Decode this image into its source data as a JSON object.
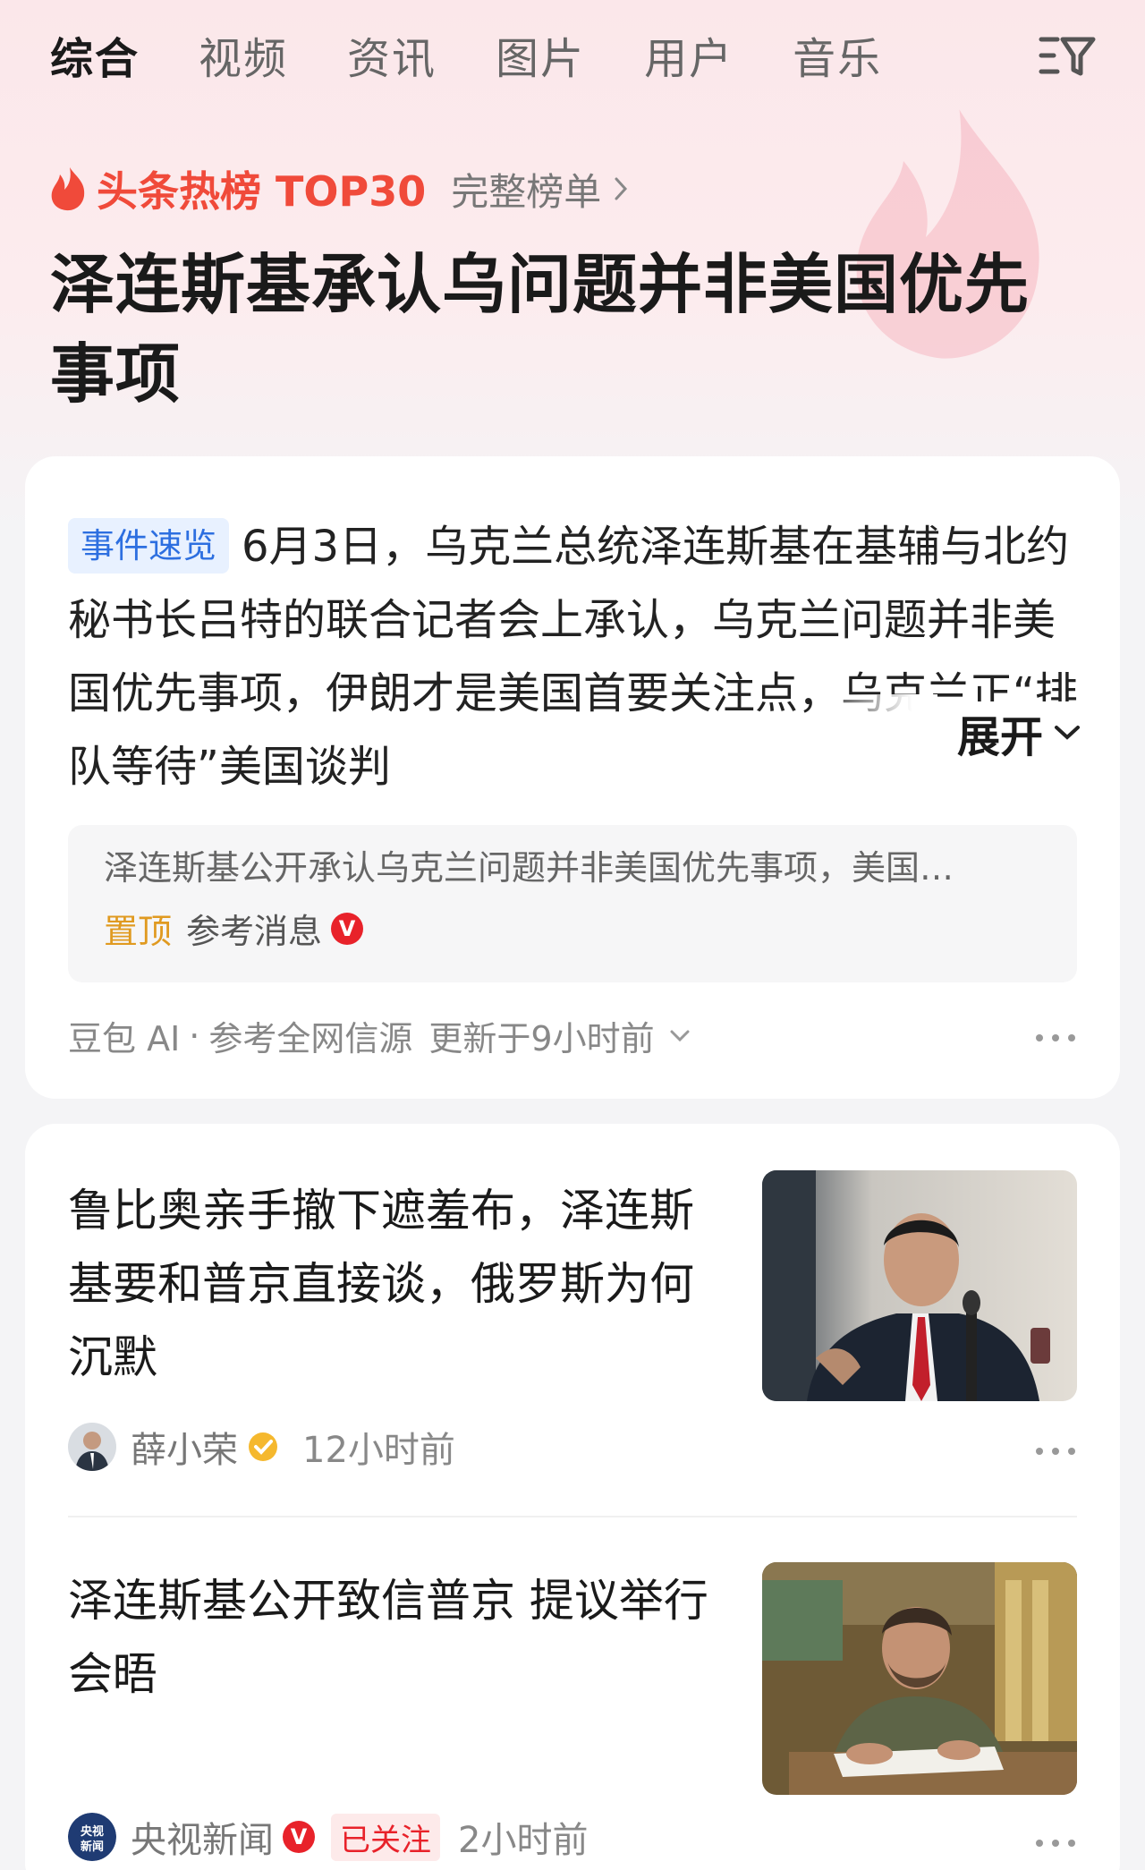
{
  "tabs": [
    "综合",
    "视频",
    "资讯",
    "图片",
    "用户",
    "音乐"
  ],
  "hot": {
    "label": "头条热榜 TOP30",
    "link": "完整榜单"
  },
  "headline": "泽连斯基承认乌问题并非美国优先事项",
  "summary_card": {
    "tag": "事件速览",
    "text": "6月3日，乌克兰总统泽连斯基在基辅与北约秘书长吕特的联合记者会上承认，乌克兰问题并非美国优先事项，伊朗才是美国首要关注点，乌克兰正“排队等待”美国谈判",
    "expand_label": "展开",
    "quote": {
      "text": "泽连斯基公开承认乌克兰问题并非美国优先事项，美国…",
      "pin": "置顶",
      "source": "参考消息",
      "badge": "V"
    },
    "footer": {
      "ai": "豆包 AI",
      "dot": "·",
      "source_note": "参考全网信源",
      "updated": "更新于9小时前"
    }
  },
  "news": [
    {
      "title": "鲁比奥亲手撤下遮羞布，泽连斯基要和普京直接谈，俄罗斯为何沉默",
      "author": "薛小荣",
      "time": "12小时前"
    },
    {
      "title": "泽连斯基公开致信普京 提议举行会晤",
      "author": "央视新闻",
      "badge": "V",
      "follow": "已关注",
      "time": "2小时前",
      "avatar_text": "央视新闻"
    }
  ],
  "colors": {
    "accent_red": "#f04a3a",
    "tag_blue": "#2d6fe0",
    "pin_orange": "#e09a20",
    "verified_red": "#e8222a"
  }
}
